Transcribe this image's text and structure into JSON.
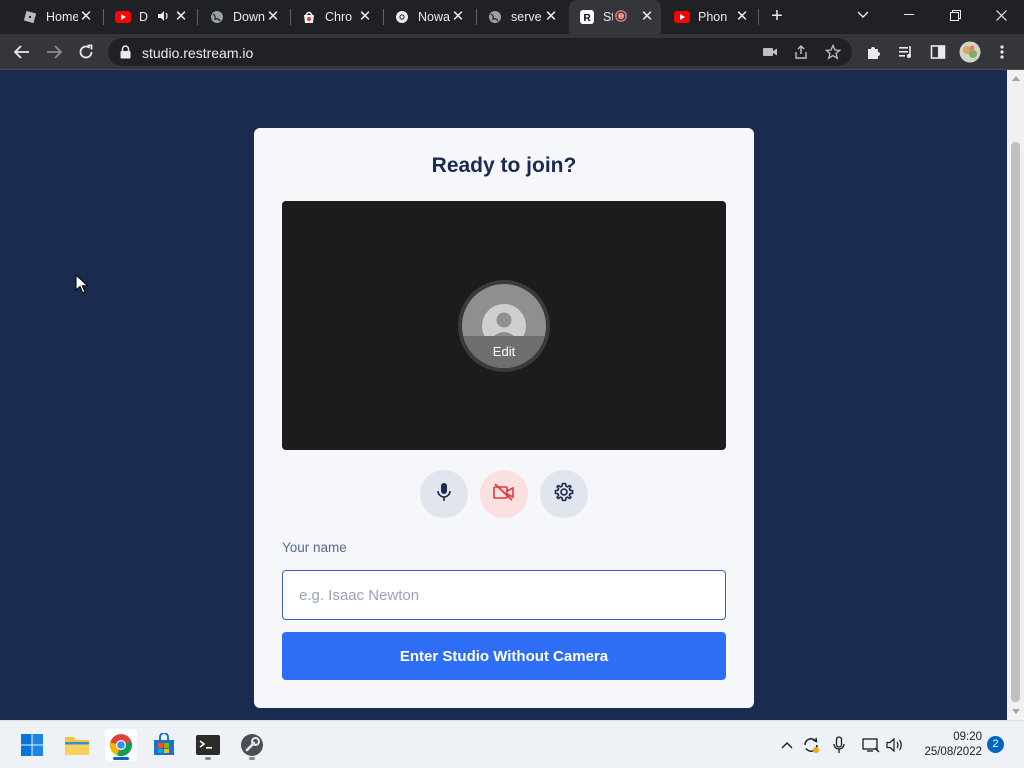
{
  "browser": {
    "tabs": [
      {
        "title": "Home",
        "icon": "roblox-icon"
      },
      {
        "title": "D",
        "icon": "youtube-icon",
        "audio": true
      },
      {
        "title": "Down",
        "icon": "globe-icon"
      },
      {
        "title": "Chro",
        "icon": "chrome-store-icon"
      },
      {
        "title": "Nowa",
        "icon": "chrome-icon"
      },
      {
        "title": "serve",
        "icon": "globe-icon"
      },
      {
        "title": "St",
        "icon": "restream-icon",
        "recording": true,
        "active": true
      },
      {
        "title": "Phon",
        "icon": "youtube-icon"
      }
    ],
    "url": "studio.restream.io"
  },
  "page": {
    "title": "Ready to join?",
    "avatar_edit_label": "Edit",
    "name_label": "Your name",
    "name_placeholder": "e.g. Isaac Newton",
    "name_value": "",
    "enter_button_label": "Enter Studio Without Camera"
  },
  "colors": {
    "page_bg": "#1a2b4f",
    "card_bg": "#f5f7fb",
    "primary": "#2e6ef5",
    "camera_off": "#e0393e"
  },
  "taskbar": {
    "apps": [
      "windows-start-icon",
      "file-explorer-icon",
      "chrome-icon",
      "microsoft-store-icon",
      "terminal-icon",
      "tool-icon"
    ],
    "time": "09:20",
    "date": "25/08/2022",
    "notifications": "2"
  }
}
